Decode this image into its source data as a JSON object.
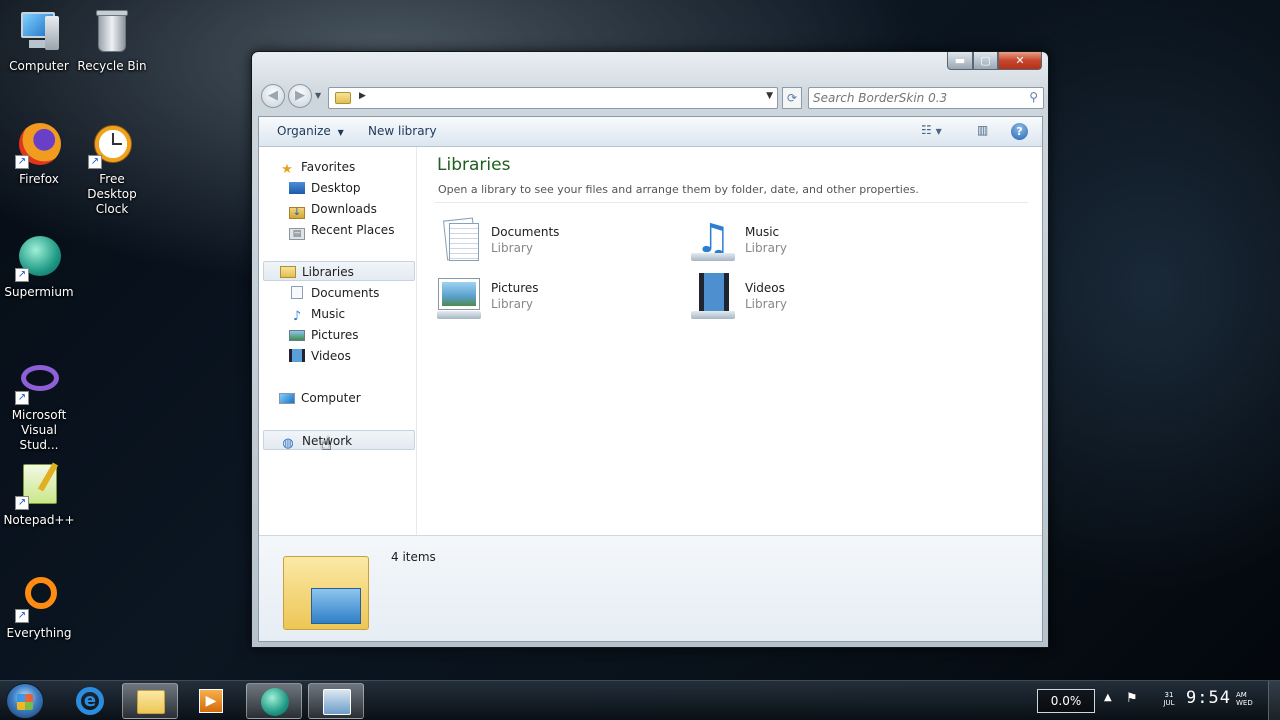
{
  "desktop": {
    "icons": [
      {
        "label": "Computer"
      },
      {
        "label": "Recycle Bin"
      },
      {
        "label": "Firefox"
      },
      {
        "label": "Free Desktop Clock"
      },
      {
        "label": "Supermium"
      },
      {
        "label": "Microsoft Visual Stud..."
      },
      {
        "label": "Notepad++"
      },
      {
        "label": "Everything"
      }
    ]
  },
  "window": {
    "caption": {
      "min": "▬",
      "max": "▢",
      "close": "✕"
    },
    "search_placeholder": "Search BorderSkin 0.3",
    "toolbar": {
      "organize": "Organize",
      "new_library": "New library",
      "help": "?"
    },
    "nav": {
      "favorites": "Favorites",
      "desktop": "Desktop",
      "downloads": "Downloads",
      "recent": "Recent Places",
      "libraries": "Libraries",
      "documents": "Documents",
      "music": "Music",
      "pictures": "Pictures",
      "videos": "Videos",
      "computer": "Computer",
      "network": "Network"
    },
    "content": {
      "title": "Libraries",
      "description": "Open a library to see your files and arrange them by folder, date, and other properties.",
      "libraries": [
        {
          "name": "Documents",
          "type": "Library"
        },
        {
          "name": "Music",
          "type": "Library"
        },
        {
          "name": "Pictures",
          "type": "Library"
        },
        {
          "name": "Videos",
          "type": "Library"
        }
      ]
    },
    "details": {
      "count": "4 items"
    }
  },
  "taskbar": {
    "cpu": "0.0%",
    "date_day": "31",
    "date_month": "JUL",
    "time": "9:54",
    "ampm": "AM",
    "weekday": "WED"
  }
}
